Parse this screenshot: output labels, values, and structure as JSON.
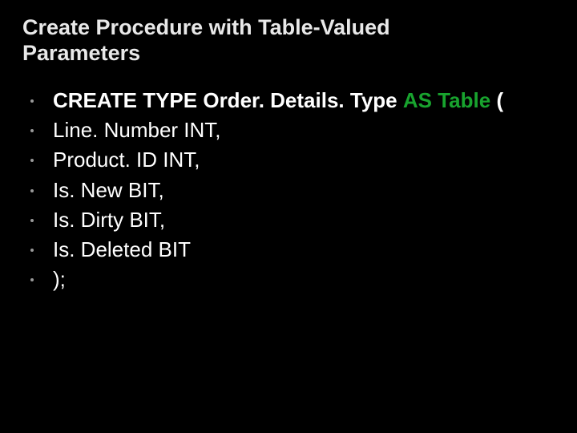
{
  "title": "Create Procedure with Table-Valued Parameters",
  "code": {
    "line1": {
      "create_type": "CREATE TYPE",
      "type_name": "Order. Details. Type",
      "as": "AS",
      "table": "Table",
      "paren": "("
    },
    "lines": [
      "Line. Number INT,",
      "Product. ID INT,",
      "Is. New BIT,",
      "Is. Dirty BIT,",
      "Is. Deleted BIT",
      ");"
    ]
  }
}
